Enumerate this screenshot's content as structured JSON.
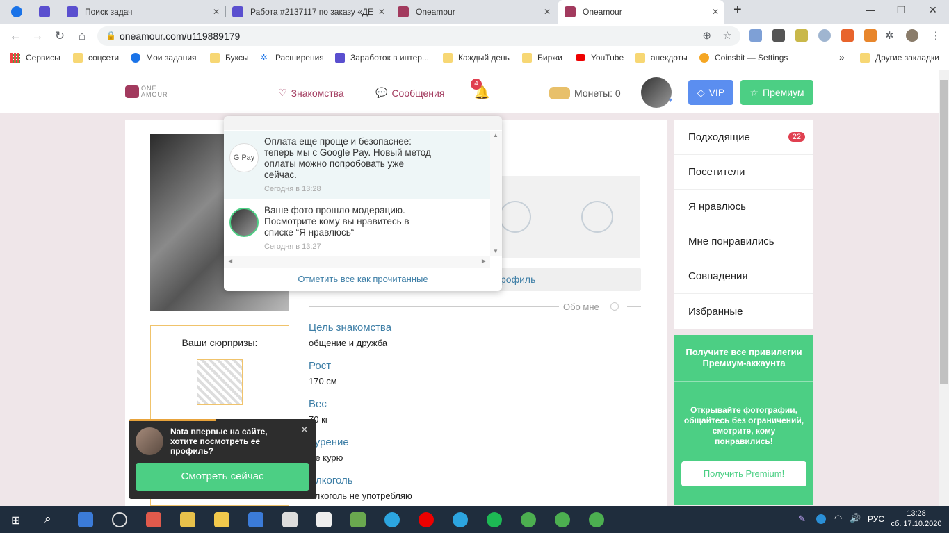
{
  "tabs": [
    {
      "label": "",
      "color": "#1a73e8"
    },
    {
      "label": "",
      "color": "#5a4fcf"
    },
    {
      "label": "Поиск задач",
      "color": "#5a4fcf"
    },
    {
      "label": "Работа #2137117 по заказу «ДЕ",
      "color": "#5a4fcf"
    },
    {
      "label": "Oneamour",
      "color": "#a23a5e"
    },
    {
      "label": "Oneamour",
      "color": "#a23a5e",
      "active": true
    }
  ],
  "toolbar": {
    "url": "oneamour.com/u119889179"
  },
  "bookmarks": [
    {
      "label": "Сервисы",
      "icon": "apps-icon"
    },
    {
      "label": "соцсети",
      "icon": "folder-icon"
    },
    {
      "label": "Мои задания",
      "icon": "site-icon"
    },
    {
      "label": "Буксы",
      "icon": "folder-icon"
    },
    {
      "label": "Расширения",
      "icon": "puzzle-icon"
    },
    {
      "label": "Заработок в интер...",
      "icon": "site-icon"
    },
    {
      "label": "Каждый день",
      "icon": "folder-icon"
    },
    {
      "label": "Биржи",
      "icon": "folder-icon"
    },
    {
      "label": "YouTube",
      "icon": "youtube-icon"
    },
    {
      "label": "анекдоты",
      "icon": "folder-icon"
    },
    {
      "label": "Coinsbit — Settings",
      "icon": "site-icon"
    },
    {
      "label": "»",
      "icon": ""
    },
    {
      "label": "Другие закладки",
      "icon": "folder-icon"
    }
  ],
  "site": {
    "logo_top": "ONE",
    "logo_bottom": "AMOUR",
    "nav_dating": "Знакомства",
    "nav_messages": "Сообщения",
    "notif_count": "4",
    "coins": "Монеты: 0",
    "vip": "VIP",
    "premium": "Премиум"
  },
  "notifications": {
    "items": [
      {
        "text": "Оплата еще проще и безопаснее: теперь мы с Google Pay. Новый метод оплаты можно попробовать уже сейчас.",
        "time": "Сегодня в 13:28",
        "avatar": "G Pay"
      },
      {
        "text": "Ваше фото прошло модерацию. Посмотрите кому вы нравитесь в списке “Я нравлюсь“",
        "time": "Сегодня в 13:27",
        "avatar": ""
      }
    ],
    "mark_all": "Отметить все как прочитанные"
  },
  "profile": {
    "surprises_title": "Ваши сюрпризы:",
    "edit_profile_partial": "рофиль",
    "about_label": "Обо мне",
    "fields": [
      {
        "label": "Цель знакомства",
        "value": "общение и дружба"
      },
      {
        "label": "Рост",
        "value": "170 см"
      },
      {
        "label": "Вес",
        "value": "70 кг"
      },
      {
        "label": "Курение",
        "value": "Не курю"
      },
      {
        "label": "Алкоголь",
        "value": "Алкоголь не употребляю"
      }
    ]
  },
  "sidebar": {
    "items": [
      {
        "label": "Подходящие",
        "badge": "22"
      },
      {
        "label": "Посетители",
        "badge": ""
      },
      {
        "label": "Я нравлюсь",
        "badge": ""
      },
      {
        "label": "Мне понравились",
        "badge": ""
      },
      {
        "label": "Совпадения",
        "badge": ""
      },
      {
        "label": "Избранные",
        "badge": ""
      }
    ]
  },
  "promo": {
    "title": "Получите все привилегии Премиум-аккаунта",
    "body": "Открывайте фотографии, общайтесь без ограничений, смотрите, кому понравились!",
    "button": "Получить Premium!"
  },
  "toast": {
    "text": "Nata впервые на сайте, хотите посмотреть ее профиль?",
    "button": "Смотреть сейчас"
  },
  "taskbar": {
    "lang": "РУС",
    "time": "13:28",
    "date": "сб. 17.10.2020"
  }
}
